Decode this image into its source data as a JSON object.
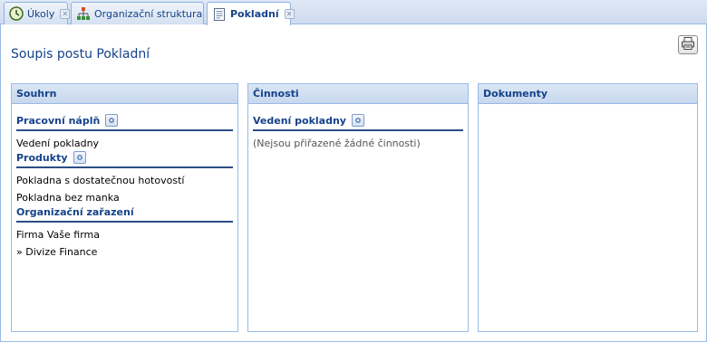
{
  "tabs": [
    {
      "label": "Úkoly",
      "icon": "clock-icon"
    },
    {
      "label": "Organizační struktura",
      "icon": "org-chart-icon"
    },
    {
      "label": "Pokladní",
      "icon": "document-icon"
    }
  ],
  "active_tab": "Pokladní",
  "page": {
    "title": "Soupis postu Pokladní",
    "print_icon": "printer-icon"
  },
  "panels": {
    "summary": {
      "header": "Souhrn",
      "sections": [
        {
          "title": "Pracovní náplň",
          "items": [
            "Vedení pokladny"
          ]
        },
        {
          "title": "Produkty",
          "items": [
            "Pokladna s dostatečnou hotovostí",
            "Pokladna bez manka"
          ]
        },
        {
          "title": "Organizační zařazení",
          "items": [
            "Firma Vaše firma",
            "» Divize Finance"
          ]
        }
      ]
    },
    "activities": {
      "header": "Činnosti",
      "sections": [
        {
          "title": "Vedení pokladny",
          "items": [
            "(Nejsou přiřazené žádné činnosti)"
          ]
        }
      ]
    },
    "documents": {
      "header": "Dokumenty"
    }
  },
  "colors": {
    "accent": "#15428b",
    "border": "#99bbe8",
    "section_rule": "#2b4e84"
  }
}
